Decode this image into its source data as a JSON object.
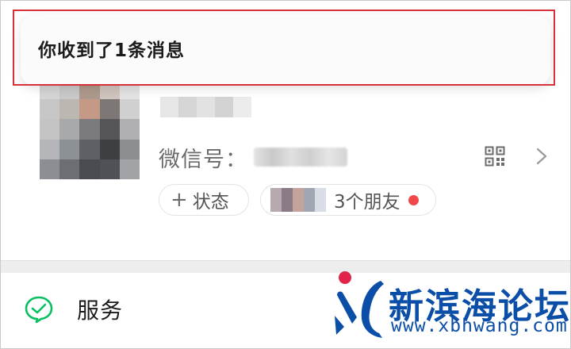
{
  "notification": {
    "message": "你收到了1条消息"
  },
  "profile": {
    "wechat_id_label": "微信号：",
    "status_button": {
      "plus": "+",
      "label": "状态"
    },
    "friends_button": {
      "label": "3个朋友"
    }
  },
  "menu": {
    "services_label": "服务"
  },
  "watermark": {
    "name": "新滨海论坛",
    "url": "www.xbhwang.com"
  },
  "colors": {
    "notification_highlight": "#d9303a",
    "badge_dot": "#f04848",
    "wechat_green": "#07c160",
    "watermark_blue": "#0b4ea8",
    "watermark_red_dot": "#e0244a"
  },
  "icons": {
    "qr": "qr-code-icon",
    "chevron": "chevron-right-icon",
    "services": "services-wallet-icon"
  }
}
